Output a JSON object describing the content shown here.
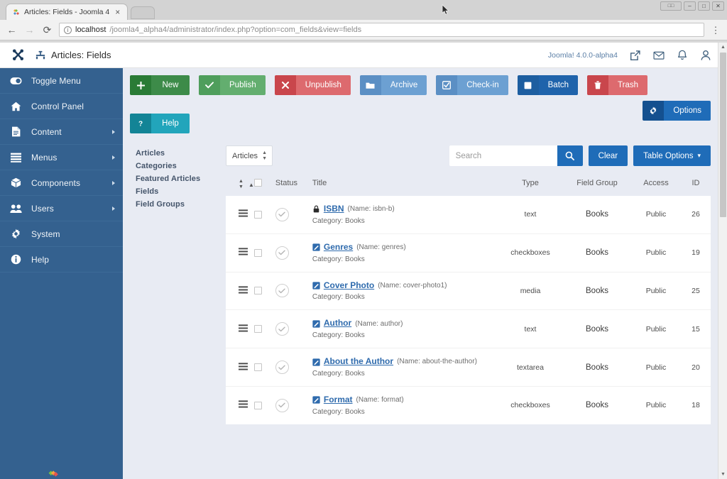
{
  "browser": {
    "tab_title": "Articles: Fields - Joomla 4",
    "tab_close": "×",
    "new_tab": "",
    "back": "←",
    "forward": "→",
    "reload": "⟳",
    "info_icon": "ⓘ",
    "url_host": "localhost",
    "url_path": "/joomla4_alpha4/administrator/index.php?option=com_fields&view=fields",
    "menu": "⋮",
    "win_extra": "□□",
    "win_minimize": "–",
    "win_maximize": "□",
    "win_close": "✕"
  },
  "header": {
    "logo": "joomla-logo",
    "page_icon": "fields-icon",
    "page_title": "Articles: Fields",
    "version": "Joomla! 4.0.0-alpha4",
    "icons": [
      {
        "name": "external-link-icon"
      },
      {
        "name": "mail-icon"
      },
      {
        "name": "bell-icon"
      },
      {
        "name": "user-icon"
      }
    ]
  },
  "sidebar": {
    "items": [
      {
        "label": "Toggle Menu",
        "icon": "toggle-icon",
        "caret": false
      },
      {
        "label": "Control Panel",
        "icon": "home-icon",
        "caret": false
      },
      {
        "label": "Content",
        "icon": "document-icon",
        "caret": true
      },
      {
        "label": "Menus",
        "icon": "list-icon",
        "caret": true
      },
      {
        "label": "Components",
        "icon": "box-icon",
        "caret": true
      },
      {
        "label": "Users",
        "icon": "users-icon",
        "caret": true
      },
      {
        "label": "System",
        "icon": "gear-icon",
        "caret": false
      },
      {
        "label": "Help",
        "icon": "info-icon",
        "caret": false
      }
    ]
  },
  "toolbar": {
    "buttons": [
      {
        "label": "New",
        "icon": "plus-icon",
        "style": "tb-green"
      },
      {
        "label": "Publish",
        "icon": "check-icon",
        "style": "tb-green2"
      },
      {
        "label": "Unpublish",
        "icon": "x-icon",
        "style": "tb-red"
      },
      {
        "label": "Archive",
        "icon": "folder-icon",
        "style": "tb-blue1"
      },
      {
        "label": "Check-in",
        "icon": "checkbox-icon",
        "style": "tb-blue1"
      },
      {
        "label": "Batch",
        "icon": "square-icon",
        "style": "tb-blue2"
      },
      {
        "label": "Trash",
        "icon": "trash-icon",
        "style": "tb-red2"
      }
    ],
    "options": {
      "label": "Options",
      "icon": "gear-icon"
    },
    "help": {
      "label": "Help",
      "icon": "question-icon"
    }
  },
  "submenu": {
    "items": [
      {
        "label": "Articles"
      },
      {
        "label": "Categories"
      },
      {
        "label": "Featured Articles"
      },
      {
        "label": "Fields"
      },
      {
        "label": "Field Groups"
      }
    ]
  },
  "filters": {
    "context_select": "Articles",
    "search_placeholder": "Search",
    "search_value": "",
    "search_icon": "search-icon",
    "clear_label": "Clear",
    "table_options_label": "Table Options",
    "table_options_caret": "▾"
  },
  "table": {
    "headers": {
      "sort": "",
      "checkbox": "",
      "status": "Status",
      "title": "Title",
      "type": "Type",
      "field_group": "Field Group",
      "access": "Access",
      "id": "ID"
    },
    "rows": [
      {
        "handle": "drag-handle-icon",
        "status": "published",
        "title_icon": "lock-icon",
        "title": "ISBN",
        "alias": "(Name: isbn-b)",
        "category": "Category: Books",
        "type": "text",
        "field_group": "Books",
        "access": "Public",
        "id": "26"
      },
      {
        "handle": "drag-handle-icon",
        "status": "published",
        "title_icon": "edit-icon",
        "title": "Genres",
        "alias": "(Name: genres)",
        "category": "Category: Books",
        "type": "checkboxes",
        "field_group": "Books",
        "access": "Public",
        "id": "19"
      },
      {
        "handle": "drag-handle-icon",
        "status": "published",
        "title_icon": "edit-icon",
        "title": "Cover Photo",
        "alias": "(Name: cover-photo1)",
        "category": "Category: Books",
        "type": "media",
        "field_group": "Books",
        "access": "Public",
        "id": "25"
      },
      {
        "handle": "drag-handle-icon",
        "status": "published",
        "title_icon": "edit-icon",
        "title": "Author",
        "alias": "(Name: author)",
        "category": "Category: Books",
        "type": "text",
        "field_group": "Books",
        "access": "Public",
        "id": "15"
      },
      {
        "handle": "drag-handle-icon",
        "status": "published",
        "title_icon": "edit-icon",
        "title": "About the Author",
        "alias": "(Name: about-the-author)",
        "category": "Category: Books",
        "type": "textarea",
        "field_group": "Books",
        "access": "Public",
        "id": "20"
      },
      {
        "handle": "drag-handle-icon",
        "status": "published",
        "title_icon": "edit-icon",
        "title": "Format",
        "alias": "(Name: format)",
        "category": "Category: Books",
        "type": "checkboxes",
        "field_group": "Books",
        "access": "Public",
        "id": "18"
      }
    ]
  },
  "colors": {
    "sidebar": "#34618f",
    "page_bg": "#e8ebf3",
    "link": "#2f6bad",
    "primary": "#1f6cb8",
    "success": "#3d8b49",
    "danger": "#dd6a6e",
    "info": "#22a5bb"
  }
}
